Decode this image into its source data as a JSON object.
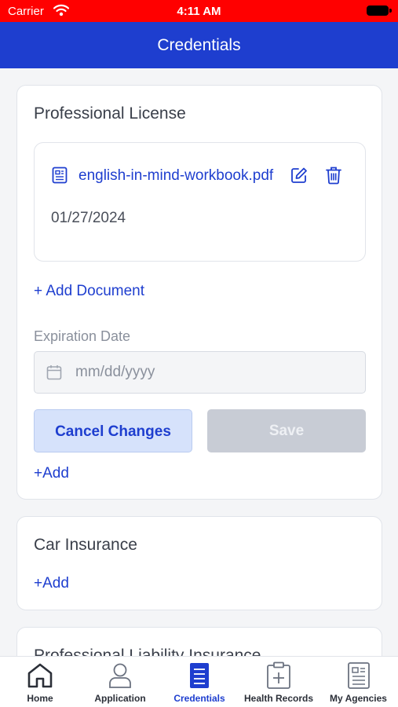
{
  "status_bar": {
    "carrier": "Carrier",
    "time": "4:11 AM"
  },
  "nav": {
    "title": "Credentials"
  },
  "professional_license": {
    "title": "Professional License",
    "document": {
      "name": "english-in-mind-workbook.pdf",
      "date": "01/27/2024"
    },
    "add_document_label": "+ Add Document",
    "expiration_label": "Expiration Date",
    "expiration_placeholder": "mm/dd/yyyy",
    "cancel_label": "Cancel Changes",
    "save_label": "Save",
    "add_label": "+Add"
  },
  "car_insurance": {
    "title": "Car Insurance",
    "add_label": "+Add"
  },
  "professional_liability": {
    "title": "Professional Liability Insurance"
  },
  "tabs": [
    {
      "label": "Home",
      "icon": "home-icon"
    },
    {
      "label": "Application",
      "icon": "person-icon"
    },
    {
      "label": "Credentials",
      "icon": "credentials-icon",
      "active": true
    },
    {
      "label": "Health Records",
      "icon": "health-records-icon"
    },
    {
      "label": "My Agencies",
      "icon": "agencies-icon"
    }
  ],
  "colors": {
    "status_bar": "#ff0000",
    "brand": "#1e3ecf",
    "disabled": "#c8ccd5",
    "text": "#3a3f4a"
  }
}
